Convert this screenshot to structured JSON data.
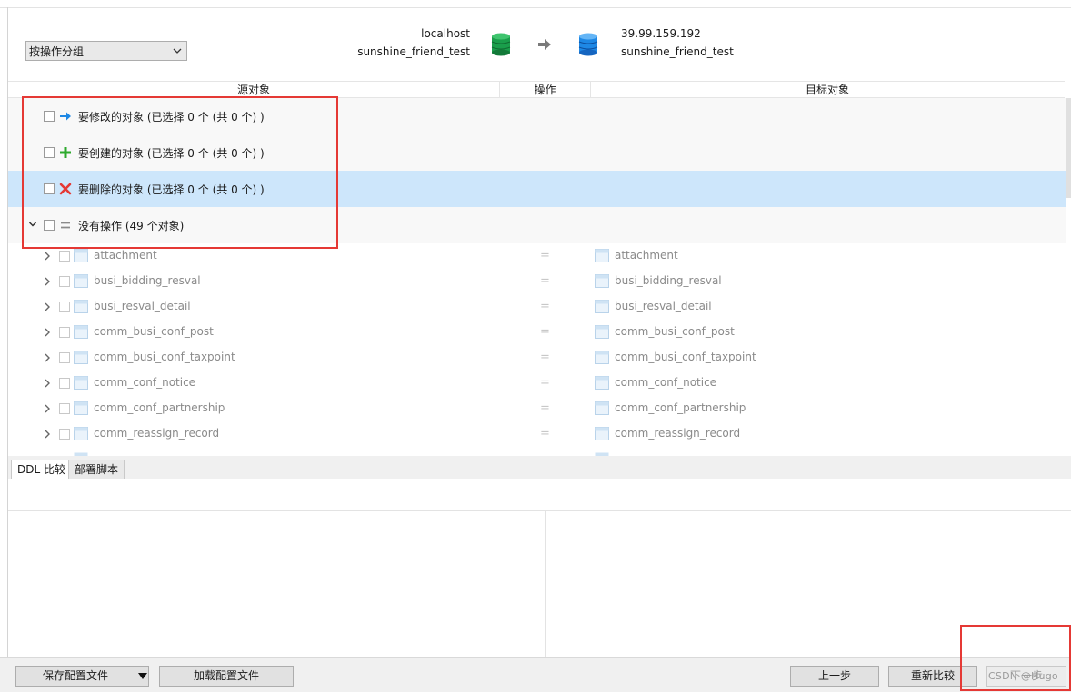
{
  "toolbar": {
    "group_select_value": "按操作分组"
  },
  "connection": {
    "source_host": "localhost",
    "source_db": "sunshine_friend_test",
    "target_host": "39.99.159.192",
    "target_db": "sunshine_friend_test"
  },
  "columns": {
    "source": "源对象",
    "operation": "操作",
    "target": "目标对象"
  },
  "groups": [
    {
      "label": "要修改的对象 (已选择 0 个 (共 0 个) )",
      "icon": "arrow-right-icon"
    },
    {
      "label": "要创建的对象 (已选择 0 个 (共 0 个) )",
      "icon": "plus-icon"
    },
    {
      "label": "要删除的对象 (已选择 0 个 (共 0 个) )",
      "icon": "cross-icon"
    },
    {
      "label": "没有操作 (49 个对象)",
      "icon": "equals-icon"
    }
  ],
  "objects": [
    {
      "source": "attachment",
      "op": "=",
      "target": "attachment"
    },
    {
      "source": "busi_bidding_resval",
      "op": "=",
      "target": "busi_bidding_resval"
    },
    {
      "source": "busi_resval_detail",
      "op": "=",
      "target": "busi_resval_detail"
    },
    {
      "source": "comm_busi_conf_post",
      "op": "=",
      "target": "comm_busi_conf_post"
    },
    {
      "source": "comm_busi_conf_taxpoint",
      "op": "=",
      "target": "comm_busi_conf_taxpoint"
    },
    {
      "source": "comm_conf_notice",
      "op": "=",
      "target": "comm_conf_notice"
    },
    {
      "source": "comm_conf_partnership",
      "op": "=",
      "target": "comm_conf_partnership"
    },
    {
      "source": "comm_reassign_record",
      "op": "=",
      "target": "comm_reassign_record"
    }
  ],
  "tabs": {
    "ddl": "DDL 比较",
    "deploy": "部署脚本"
  },
  "footer": {
    "save_config": "保存配置文件",
    "load_config": "加载配置文件",
    "prev": "上一步",
    "recompare": "重新比较",
    "next": "下一步",
    "watermark": "CSDN @Hugo"
  },
  "colors": {
    "selected_row": "#cde6fb",
    "highlight_box": "#e53935",
    "db_green": "#1a9e4b",
    "db_blue": "#1e88e5"
  }
}
